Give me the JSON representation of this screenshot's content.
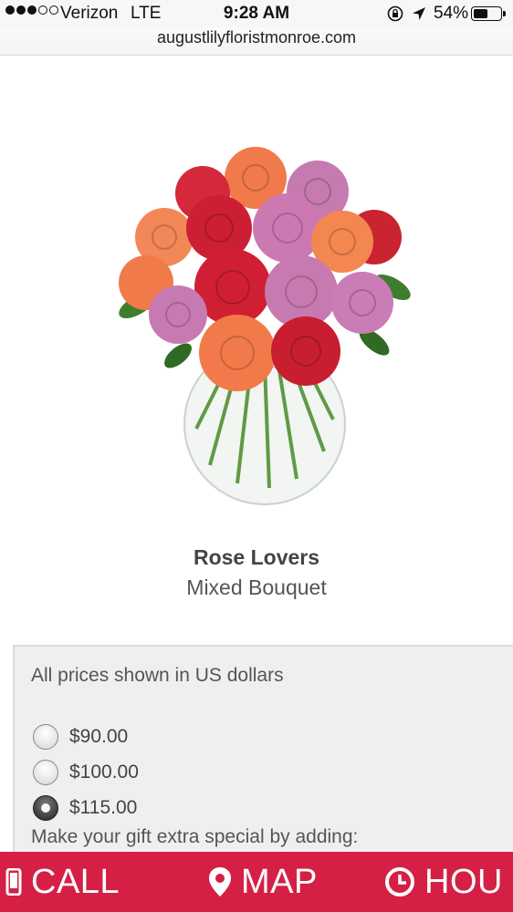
{
  "status_bar": {
    "carrier": "Verizon",
    "network": "LTE",
    "time": "9:28 AM",
    "battery_percent": "54%",
    "battery_level": 0.54,
    "signal_bars_filled": 3,
    "signal_bars_total": 5
  },
  "browser": {
    "url": "augustlilyfloristmonroe.com"
  },
  "product": {
    "name": "Rose Lovers",
    "subtitle": "Mixed Bouquet"
  },
  "pricing": {
    "note": "All prices shown in US dollars",
    "options": [
      {
        "label": "$90.00",
        "selected": false
      },
      {
        "label": "$100.00",
        "selected": false
      },
      {
        "label": "$115.00",
        "selected": true
      }
    ],
    "extra_text": "Make your gift extra special by adding:"
  },
  "bottom_bar": {
    "items": [
      {
        "label": "CALL",
        "icon": "phone-icon"
      },
      {
        "label": "MAP",
        "icon": "map-pin-icon"
      },
      {
        "label": "HOU",
        "icon": "clock-icon"
      }
    ]
  },
  "colors": {
    "accent": "#d51f45",
    "price_box_bg": "#efefef"
  }
}
